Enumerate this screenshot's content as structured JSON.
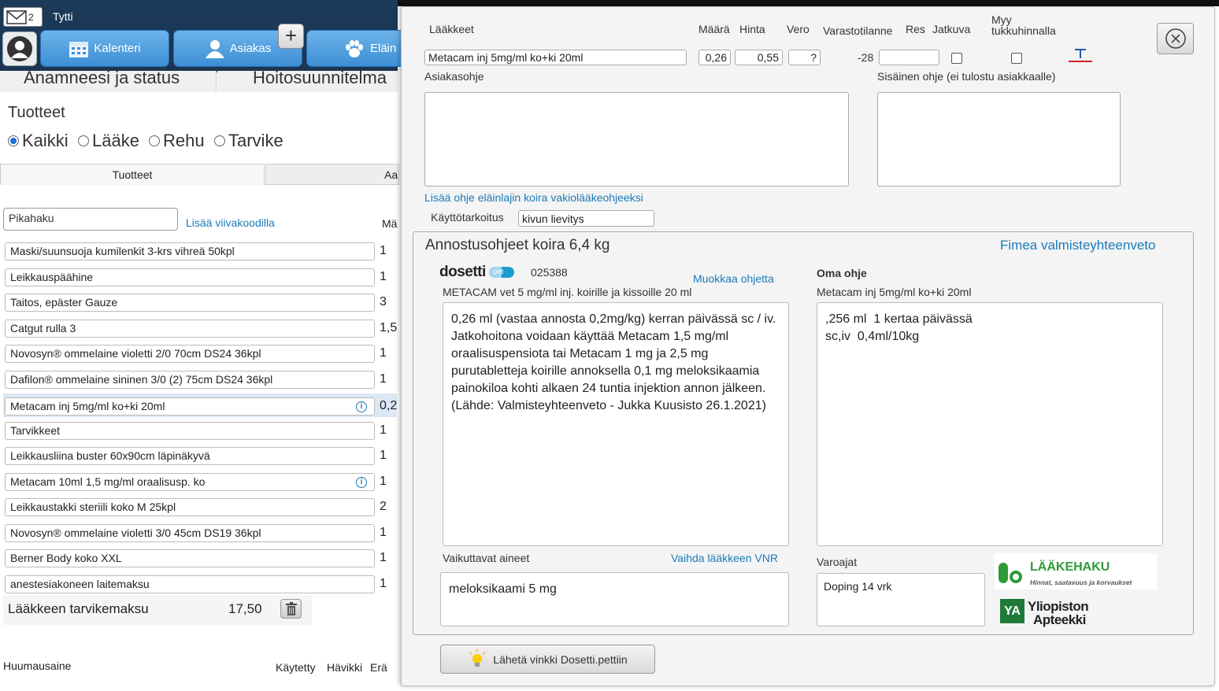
{
  "topbar": {
    "mail_count": "2",
    "username": "Tytti",
    "nav": [
      "Kalenteri",
      "Asiakas",
      "Eläin"
    ],
    "plus": "+"
  },
  "left": {
    "tab_anamneesi": "Anamneesi ja status",
    "tab_hoito": "Hoitosuunnitelma",
    "products_title": "Tuotteet",
    "filters": [
      "Kaikki",
      "Lääke",
      "Rehu",
      "Tarvike"
    ],
    "selected_filter": "Kaikki",
    "subtabs": [
      "Tuotteet",
      "Aa"
    ],
    "quicksearch_placeholder": "Pikahaku",
    "barcode_link": "Lisää viivakoodilla",
    "qty_header": "Mä",
    "products": [
      {
        "name": "Maski/suunsuoja kumilenkit 3-krs vihreä 50kpl",
        "qty": "1"
      },
      {
        "name": "Leikkauspäähine",
        "qty": "1"
      },
      {
        "name": "Taitos, epäster Gauze",
        "qty": "3"
      },
      {
        "name": "Catgut rulla 3",
        "qty": "1,5"
      },
      {
        "name": "Novosyn® ommelaine violetti 2/0 70cm DS24 36kpl",
        "qty": "1"
      },
      {
        "name": "Dafilon® ommelaine sininen 3/0 (2) 75cm DS24 36kpl",
        "qty": "1"
      },
      {
        "name": "Metacam inj 5mg/ml ko+ki 20ml",
        "qty": "0,2"
      },
      {
        "name": "Tarvikkeet",
        "qty": "1"
      },
      {
        "name": "Leikkausliina buster 60x90cm läpinäkyvä",
        "qty": "1"
      },
      {
        "name": "Metacam 10ml 1,5 mg/ml oraalisusp. ko",
        "qty": "1"
      },
      {
        "name": "Leikkaustakki steriili koko M 25kpl",
        "qty": "2"
      },
      {
        "name": "Novosyn® ommelaine violetti 3/0 45cm DS19 36kpl",
        "qty": "1"
      },
      {
        "name": "Berner Body koko XXL",
        "qty": "1"
      },
      {
        "name": "anestesiakoneen laitemaksu",
        "qty": "1"
      }
    ],
    "fee_label": "Lääkkeen tarvikemaksu",
    "fee_value": "17,50",
    "narcotic_label": "Huumausaine",
    "col_used": "Käytetty",
    "col_waste": "Hävikki",
    "col_batch": "Erä"
  },
  "dialog": {
    "headers": {
      "drug": "Lääkkeet",
      "amount": "Määrä",
      "price": "Hinta",
      "tax": "Vero",
      "stock": "Varastotilanne",
      "res": "Res",
      "continuous": "Jatkuva",
      "wholesale": "Myy tukkuhinnalla"
    },
    "drug_name": "Metacam inj 5mg/ml ko+ki 20ml",
    "amount": "0,26",
    "price": "0,55",
    "tax": "?",
    "stock": "-28",
    "customer_instr_label": "Asiakasohje",
    "internal_instr_label": "Sisäinen ohje (ei tulostu asiakkaalle)",
    "add_std_link": "Lisää ohje eläinlajin koira vakiolääkeohjeeksi",
    "purpose_label": "Käyttötarkoitus",
    "purpose_value": "kivun lievitys",
    "dosing": {
      "title": "Annostusohjeet koira 6,4 kg",
      "fimea_link": "Fimea valmisteyhteenveto",
      "dosetti_logo": "dosetti",
      "dosetti_pet": "pet",
      "vnr": "025388",
      "edit_link": "Muokkaa ohjetta",
      "product_line": "METACAM vet 5 mg/ml inj. koirille ja kissoille 20 ml",
      "dosetti_text": "0,26 ml (vastaa annosta 0,2mg/kg) kerran päivässä sc / iv. Jatkohoitona voidaan käyttää Metacam 1,5 mg/ml oraalisuspensiota tai Metacam 1 mg ja 2,5 mg purutabletteja koirille annoksella 0,1 mg meloksikaamia painokiloa kohti alkaen 24 tuntia injektion annon jälkeen.\n(Lähde: Valmisteyhteenveto - Jukka Kuusisto 26.1.2021)",
      "own_label": "Oma ohje",
      "own_product": "Metacam inj 5mg/ml ko+ki 20ml",
      "own_text": ",256 ml  1 kertaa päivässä\nsc,iv  0,4ml/10kg",
      "active_label": "Vaikuttavat aineet",
      "change_vnr_link": "Vaihda lääkkeen VNR",
      "active_value": "meloksikaami 5 mg",
      "withdrawal_label": "Varoajat",
      "withdrawal_value": "Doping 14 vrk",
      "laakehaku_title": "LÄÄKEHAKU",
      "laakehaku_sub": "Hinnat, saatavuus ja korvaukset",
      "ya_logo": "YA",
      "yliopiston1": "Yliopiston",
      "yliopiston2": "Apteekki"
    },
    "tip_button": "Lähetä vinkki Dosetti.pettiin",
    "colors": {
      "link": "#1b7bb8",
      "nav_blue": "#3c8fd6",
      "laakehaku_green": "#2e9a3a"
    }
  }
}
